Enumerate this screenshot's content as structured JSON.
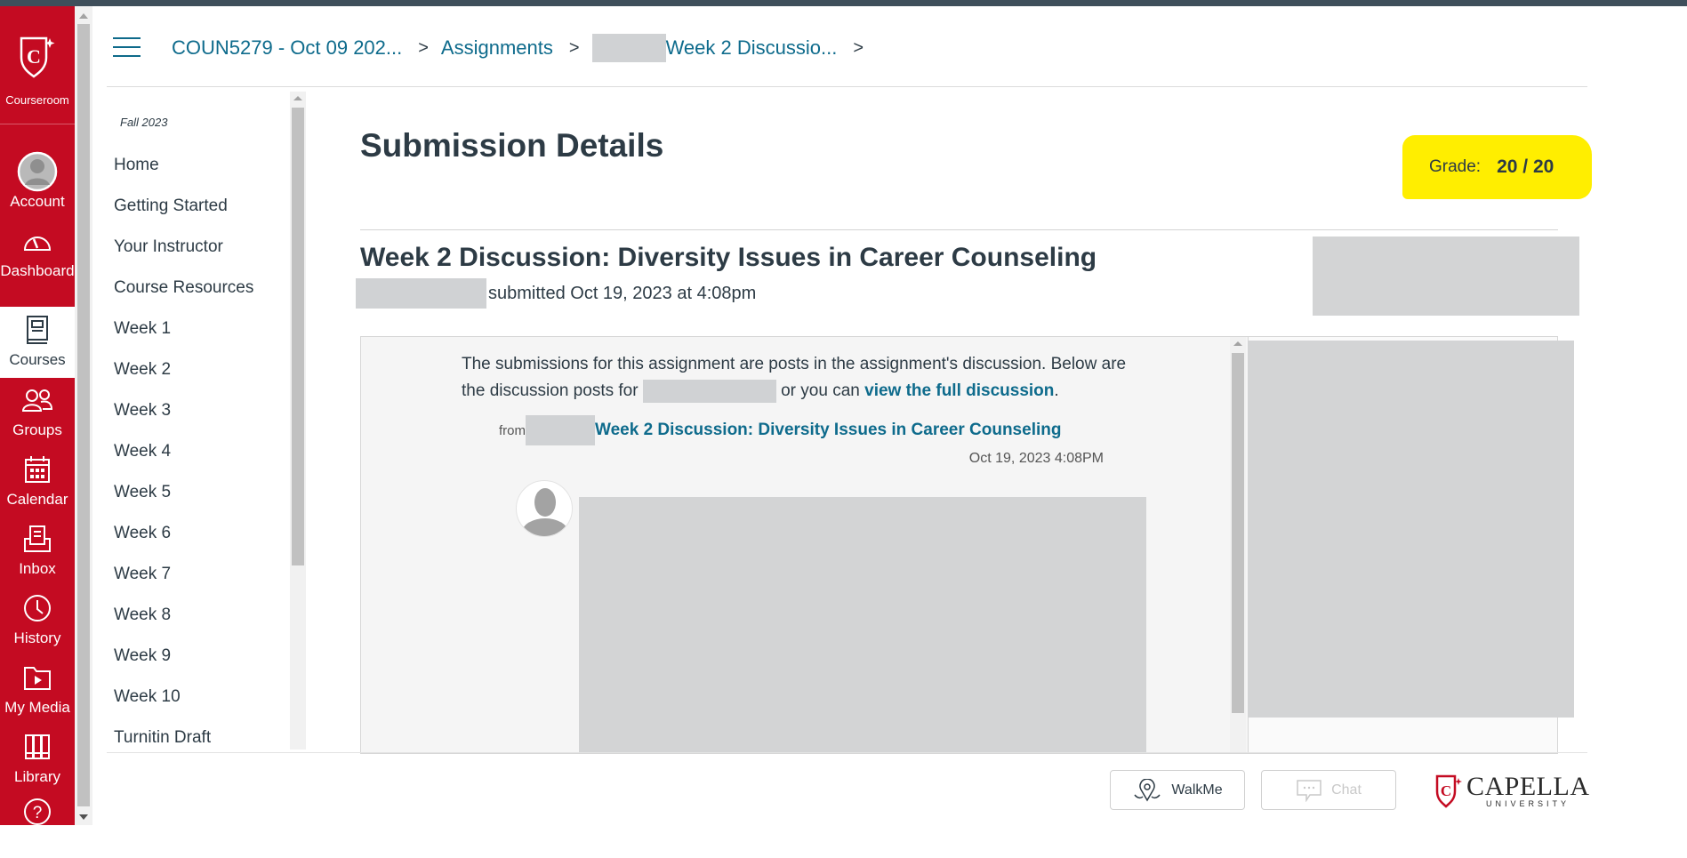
{
  "global_nav": {
    "brand_label": "Courseroom",
    "items": [
      {
        "label": "Account",
        "icon": "account-avatar-icon"
      },
      {
        "label": "Dashboard",
        "icon": "dashboard-gauge-icon"
      },
      {
        "label": "Courses",
        "icon": "courses-book-icon",
        "active": true
      },
      {
        "label": "Groups",
        "icon": "groups-icon"
      },
      {
        "label": "Calendar",
        "icon": "calendar-icon"
      },
      {
        "label": "Inbox",
        "icon": "inbox-icon"
      },
      {
        "label": "History",
        "icon": "history-clock-icon"
      },
      {
        "label": "My Media",
        "icon": "my-media-icon"
      },
      {
        "label": "Library",
        "icon": "library-icon"
      },
      {
        "label": "",
        "icon": "help-icon"
      }
    ],
    "colors": {
      "brand_red": "#c40b22"
    }
  },
  "breadcrumb": {
    "course": "COUN5279 - Oct 09 202...",
    "assignments": "Assignments",
    "assignment": "Week 2 Discussio...",
    "separator": ">"
  },
  "course_nav": {
    "term": "Fall 2023",
    "items": [
      "Home",
      "Getting Started",
      "Your Instructor",
      "Course Resources",
      "Week 1",
      "Week 2",
      "Week 3",
      "Week 4",
      "Week 5",
      "Week 6",
      "Week 7",
      "Week 8",
      "Week 9",
      "Week 10",
      "Turnitin Draft"
    ]
  },
  "main": {
    "page_title": "Submission Details",
    "grade_label": "Grade:",
    "grade_value": "20 / 20",
    "assignment_title": "Week 2 Discussion: Diversity Issues in Career Counseling",
    "submitted_text": "submitted Oct 19, 2023 at 4:08pm",
    "discussion": {
      "intro_part1": "The submissions for this assignment are posts in the assignment's discussion. Below are the discussion posts for",
      "intro_part2": "or you can",
      "full_discussion_link": "view the full discussion",
      "intro_end": ".",
      "from_label": "from",
      "topic_link": "Week 2 Discussion: Diversity Issues in Career Counseling",
      "post_date": "Oct 19, 2023 4:08PM"
    },
    "colors": {
      "link": "#0e6b8c",
      "grade_highlight": "#ffee00"
    }
  },
  "footer": {
    "walkme_label": "WalkMe",
    "chat_label": "Chat",
    "logo_name": "CAPELLA",
    "logo_sub": "UNIVERSITY"
  }
}
